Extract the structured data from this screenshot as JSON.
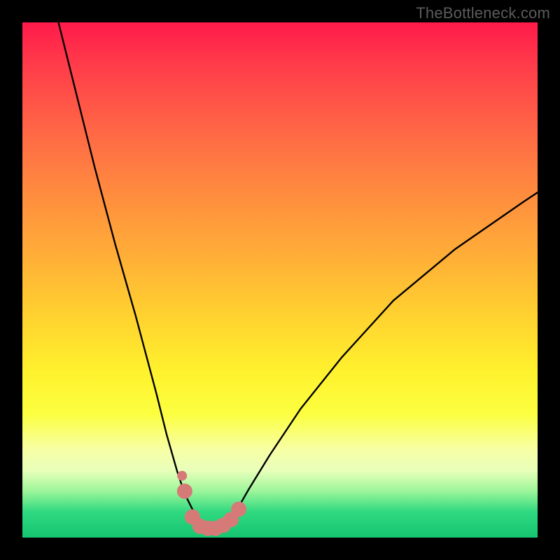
{
  "watermark": "TheBottleneck.com",
  "chart_data": {
    "type": "line",
    "title": "",
    "xlabel": "",
    "ylabel": "",
    "xlim": [
      0,
      100
    ],
    "ylim": [
      0,
      100
    ],
    "grid": false,
    "legend": false,
    "series": [
      {
        "name": "left-curve",
        "x": [
          7,
          10,
          14,
          18,
          22,
          26,
          28,
          30,
          31,
          32,
          33,
          34,
          35,
          36,
          37
        ],
        "y": [
          100,
          88,
          72,
          57,
          43,
          28,
          20,
          13,
          10,
          7.5,
          5.5,
          4,
          2.8,
          2.0,
          1.7
        ]
      },
      {
        "name": "right-curve",
        "x": [
          37,
          38,
          39,
          40,
          41,
          42,
          44,
          48,
          54,
          62,
          72,
          84,
          97,
          100
        ],
        "y": [
          1.7,
          1.8,
          2.3,
          3.2,
          4.5,
          6.0,
          9.5,
          16,
          25,
          35,
          46,
          56,
          65,
          67
        ]
      },
      {
        "name": "highlight-dots",
        "x": [
          31.5,
          33,
          34.5,
          36,
          37.5,
          39,
          40.5,
          42
        ],
        "y": [
          9,
          4,
          2.2,
          1.8,
          1.8,
          2.4,
          3.5,
          5.5
        ]
      }
    ],
    "curve_color": "#000000",
    "highlight_color": "#d67a78",
    "background_gradient": [
      "#ff1a4b",
      "#fff22e",
      "#16c571"
    ]
  }
}
